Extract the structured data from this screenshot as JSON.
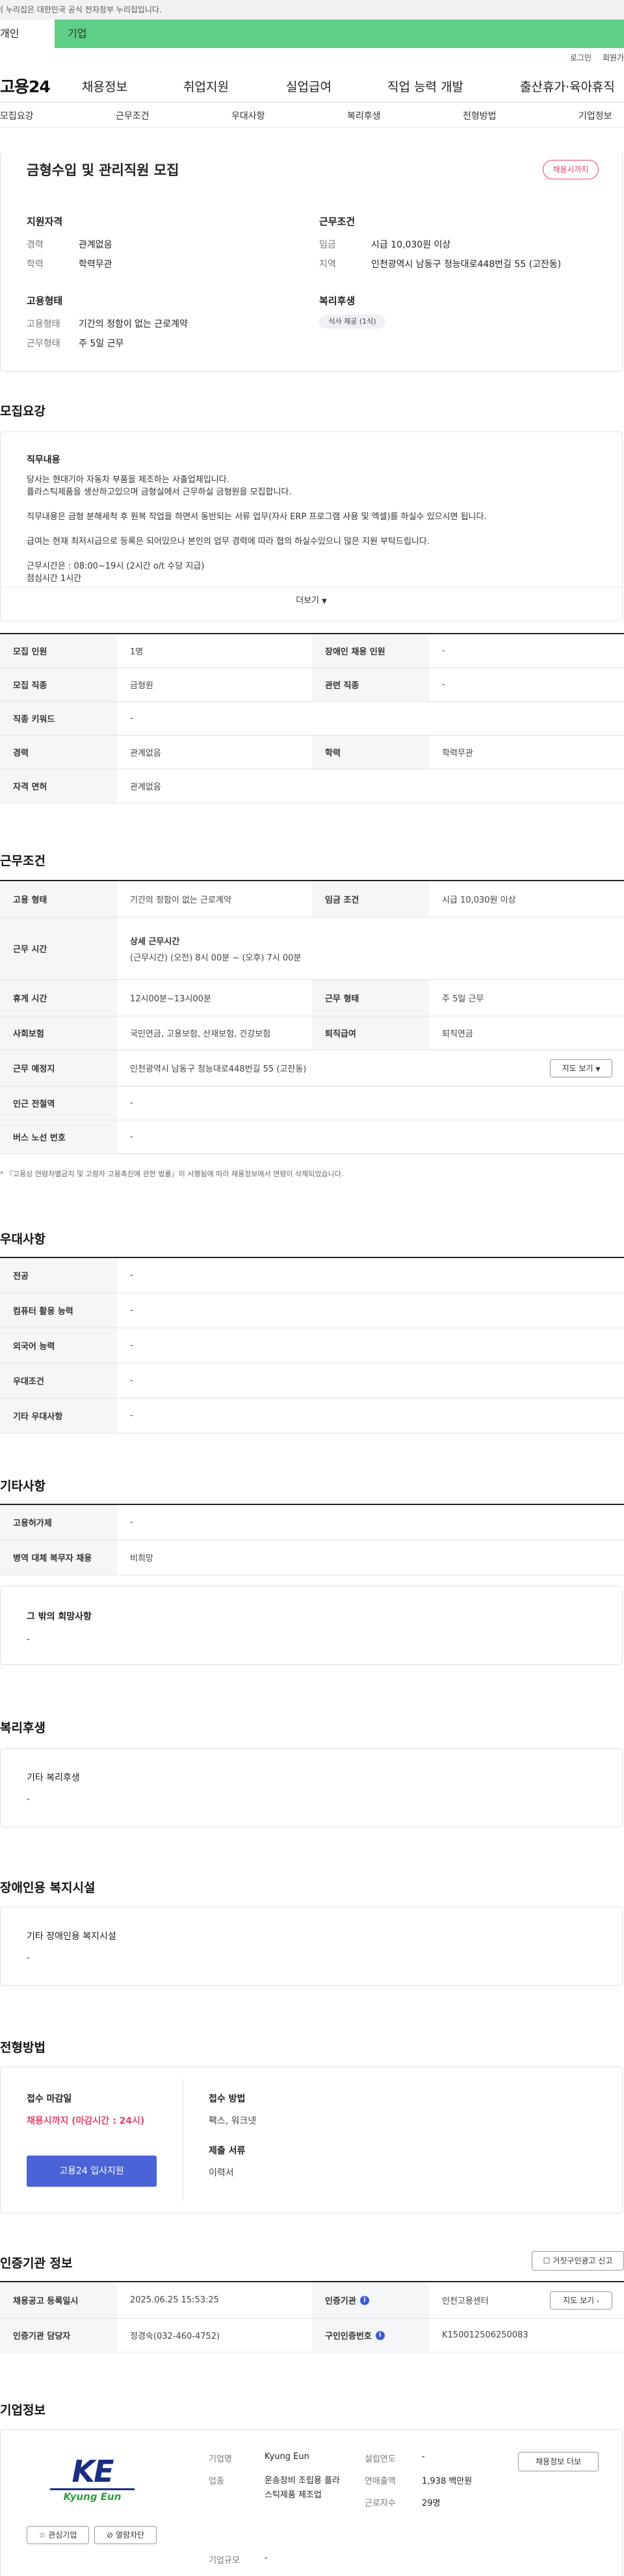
{
  "gov_banner": "이 누리집은 대한민국 공식 전자정부 누리집입니다.",
  "user_tabs": {
    "person": "개인",
    "company": "기업"
  },
  "util": {
    "login": "로그인",
    "join": "회원가"
  },
  "logo": "고용24",
  "gnb": [
    "채용정보",
    "취업지원",
    "실업급여",
    "직업 능력 개발",
    "출산휴가·육아휴직"
  ],
  "subnav": [
    "모집요강",
    "근무조건",
    "우대사항",
    "복리후생",
    "전형방법",
    "기업정보"
  ],
  "summary": {
    "title": "금형수입 및 관리직원 모집",
    "status_badge": "채용시까지",
    "qualification_title": "지원자격",
    "career_label": "경력",
    "career_value": "관계없음",
    "education_label": "학력",
    "education_value": "학력무관",
    "employment_title": "고용형태",
    "employment_label": "고용형태",
    "employment_value": "기간의 정함이 없는 근로계약",
    "worktype_label": "근무형태",
    "worktype_value": "주 5일 근무",
    "conditions_title": "근무조건",
    "wage_label": "임금",
    "wage_value": "시급 10,030원 이상",
    "region_label": "지역",
    "region_value": "인천광역시 남동구 청능대로448번길 55 (고잔동)",
    "welfare_title": "복리후생",
    "welfare_badge": "식사 제공 (1식)"
  },
  "recruit": {
    "section_title": "모집요강",
    "duty_title": "직무내용",
    "duty_lines": [
      "당사는 현대기아 자동차 부품을 제조하는 사출업체입니다.",
      "플라스틱제품을 생산하고있으며 금형실에서 근무하실 금형원을 모집합니다.",
      "",
      "직무내용은 금형 분해세척 후 원복 작업을 하면서 동반되는 서류 업무(자사 ERP 프로그램 사용 및 엑셀)를 하실수 있으시면 됩니다.",
      "",
      "급여는 현재 최저시급으로 등록은 되어있으나 본인의 업무 경력에 따라 협의 하실수있으니 많은 지원 부탁드립니다.",
      "",
      "근무시간은 : 08:00~19시 (2시간 o/t 수당 지급)",
      "점심시간 1시간"
    ],
    "more_button": "더보기",
    "rows": [
      {
        "h1": "모집 인원",
        "v1": "1명",
        "h2": "장애인 채용 인원",
        "v2": "-"
      },
      {
        "h1": "모집 직종",
        "v1": "금형원",
        "h2": "관련 직종",
        "v2": "-"
      },
      {
        "h1": "직종 키워드",
        "v1": "-"
      },
      {
        "h1": "경력",
        "v1": "관계없음",
        "h2": "학력",
        "v2": "학력무관"
      },
      {
        "h1": "자격 면허",
        "v1": "관계없음"
      }
    ]
  },
  "work": {
    "section_title": "근무조건",
    "employ_h": "고용 형태",
    "employ_v": "기간의 정함이 없는 근로계약",
    "wage_h": "임금 조건",
    "wage_v": "시급 10,030원 이상",
    "hours_h": "근무 시간",
    "hours_title": "상세 근무시간",
    "hours_v": "(근무시간) (오전) 8시 00분 ~ (오후) 7시 00분",
    "break_h": "휴게 시간",
    "break_v": "12시00분~13시00분",
    "worktype_h": "근무 형태",
    "worktype_v": "주 5일 근무",
    "insurance_h": "사회보험",
    "insurance_v": "국민연금, 고용보험, 산재보험, 건강보험",
    "retire_h": "퇴직급여",
    "retire_v": "퇴직연금",
    "place_h": "근무 예정지",
    "place_v": "인천광역시 남동구 청능대로448번길 55 (고잔동)",
    "map_button": "지도 보기",
    "station_h": "인근 전철역",
    "station_v": "-",
    "bus_h": "버스 노선 번호",
    "bus_v": "-",
    "note": "* 『고용상 연령차별금지 및 고령자 고용촉진에 관한 법률』이 시행됨에 따라 채용정보에서 연령이 삭제되었습니다."
  },
  "prefer": {
    "section_title": "우대사항",
    "rows": [
      {
        "h": "전공",
        "v": "-"
      },
      {
        "h": "컴퓨터 활용 능력",
        "v": "-"
      },
      {
        "h": "외국어 능력",
        "v": "-"
      },
      {
        "h": "우대조건",
        "v": "-"
      },
      {
        "h": "기타 우대사항",
        "v": "-"
      }
    ]
  },
  "etc": {
    "section_title": "기타사항",
    "rows": [
      {
        "h": "고용허가제",
        "v": "-"
      },
      {
        "h": "병역 대체 복무자 채용",
        "v": "비희망"
      }
    ],
    "wish_title": "그 밖의 희망사항",
    "wish_value": "-"
  },
  "welfare": {
    "section_title": "복리후생",
    "card_title": "기타 복리후생",
    "card_value": "-"
  },
  "disability": {
    "section_title": "장애인용 복지시설",
    "card_title": "기타 장애인용 복지시설",
    "card_value": "-"
  },
  "process": {
    "section_title": "전형방법",
    "deadline_title": "접수 마감일",
    "deadline_value": "채용시까지 (마감시간 : 24시)",
    "apply_button": "고용24 입사지원",
    "method_title": "접수 방법",
    "method_value": "팩스, 워크넷",
    "docs_title": "제출 서류",
    "docs_value": "이력서"
  },
  "agency": {
    "section_title": "인증기관 정보",
    "report_button": "거짓구인광고 신고",
    "date_h": "채용공고 등록일시",
    "date_v": "2025.06.25 15:53:25",
    "agency_h": "인증기관",
    "agency_v": "인천고용센터",
    "map_button": "지도 보기",
    "manager_h": "인증기관 담당자",
    "manager_v": "정경숙(032-460-4752)",
    "id_h": "구인인증번호",
    "id_v": "K150012506250083"
  },
  "company": {
    "section_title": "기업정보",
    "logo_mark": "KE",
    "logo_sub": "Kyung Eun",
    "interest_button": "관심기업",
    "block_button": "열람차단",
    "name_label": "기업명",
    "name_value": "Kyung Eun",
    "industry_label": "업종",
    "industry_value": "운송장비 조립용 플라스틱제품 제조업",
    "size_label": "기업규모",
    "size_value": "-",
    "founded_label": "설립연도",
    "founded_value": "-",
    "sales_label": "연매출액",
    "sales_value": "1,938 백만원",
    "employees_label": "근로자수",
    "employees_value": "29명",
    "more_button": "채용정보 더보"
  },
  "colors": {
    "brand_green": "#5fcf86",
    "status_pink": "#e2466c",
    "apply_blue": "#4a63d6",
    "logo_navy": "#1b2e82",
    "logo_green": "#2f9e3e"
  }
}
